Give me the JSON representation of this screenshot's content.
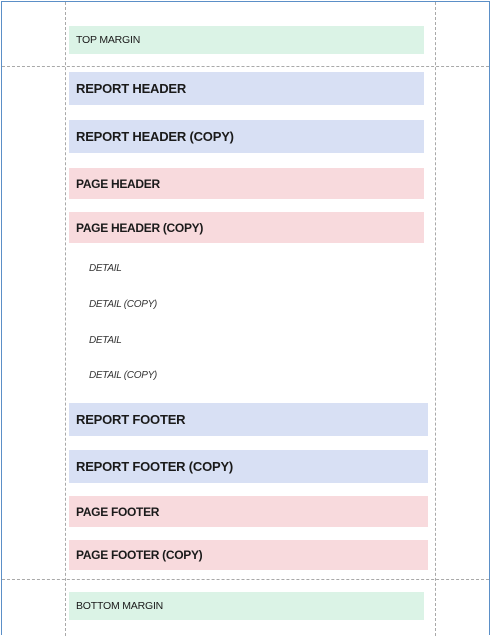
{
  "bands": {
    "top_margin": "TOP MARGIN",
    "report_header": "REPORT HEADER",
    "report_header_copy": "REPORT HEADER (COPY)",
    "page_header": "PAGE HEADER",
    "page_header_copy": "PAGE HEADER (COPY)",
    "detail_1": "DETAIL",
    "detail_copy_1": "DETAIL (COPY)",
    "detail_2": "DETAIL",
    "detail_copy_2": "DETAIL (COPY)",
    "report_footer": "REPORT FOOTER",
    "report_footer_copy": "REPORT FOOTER (COPY)",
    "page_footer": "PAGE FOOTER",
    "page_footer_copy": "PAGE FOOTER (COPY)",
    "bottom_margin": "BOTTOM MARGIN"
  },
  "colors": {
    "frame_border": "#5b8fc7",
    "margin_band": "#dbf3e6",
    "report_band": "#d8e0f4",
    "page_band": "#f8dadd",
    "guide_line": "#a9a9a9"
  }
}
